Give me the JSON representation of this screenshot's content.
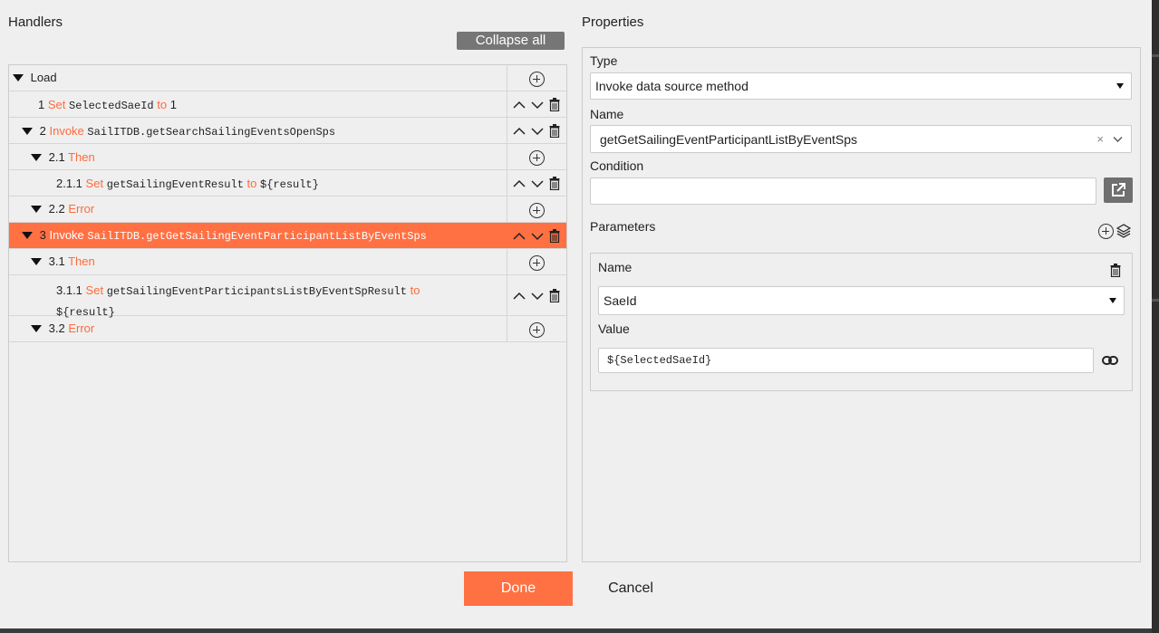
{
  "handlers": {
    "title": "Handlers",
    "collapse_label": "Collapse all",
    "rows": [
      {
        "num": "",
        "text": "Load"
      },
      {
        "num": "1",
        "kw": "Set",
        "target": "SelectedSaeId",
        "kw2": "to",
        "value": "1"
      },
      {
        "num": "2",
        "kw": "Invoke",
        "target": "SailITDB.getSearchSailingEventsOpenSps"
      },
      {
        "num": "2.1",
        "kw": "Then"
      },
      {
        "num": "2.1.1",
        "kw": "Set",
        "target": "getSailingEventResult",
        "kw2": "to",
        "value": "${result}"
      },
      {
        "num": "2.2",
        "kw": "Error"
      },
      {
        "num": "3",
        "kw": "Invoke",
        "target": "SailITDB.getGetSailingEventParticipantListByEventSps"
      },
      {
        "num": "3.1",
        "kw": "Then"
      },
      {
        "num": "3.1.1",
        "kw": "Set",
        "target": "getSailingEventParticipantsListByEventSpResult",
        "kw2": "to",
        "value": "${result}"
      },
      {
        "num": "3.2",
        "kw": "Error"
      }
    ]
  },
  "properties": {
    "title": "Properties",
    "type_label": "Type",
    "type_value": "Invoke data source method",
    "name_label": "Name",
    "name_value": "getGetSailingEventParticipantListByEventSps",
    "clear_glyph": "×",
    "condition_label": "Condition",
    "condition_value": "",
    "parameters_label": "Parameters",
    "param": {
      "name_label": "Name",
      "name_value": "SaeId",
      "value_label": "Value",
      "value_value": "${SelectedSaeId}"
    }
  },
  "footer": {
    "done_label": "Done",
    "cancel_label": "Cancel"
  },
  "colors": {
    "accent": "#ff7043",
    "keyword": "#ff6a3d",
    "collapse_button": "#767676"
  },
  "icons": [
    "add-circle-icon",
    "chevron-up-icon",
    "chevron-down-icon",
    "trash-icon",
    "external-link-icon",
    "layers-icon",
    "link-icon",
    "triangle-down-icon"
  ]
}
